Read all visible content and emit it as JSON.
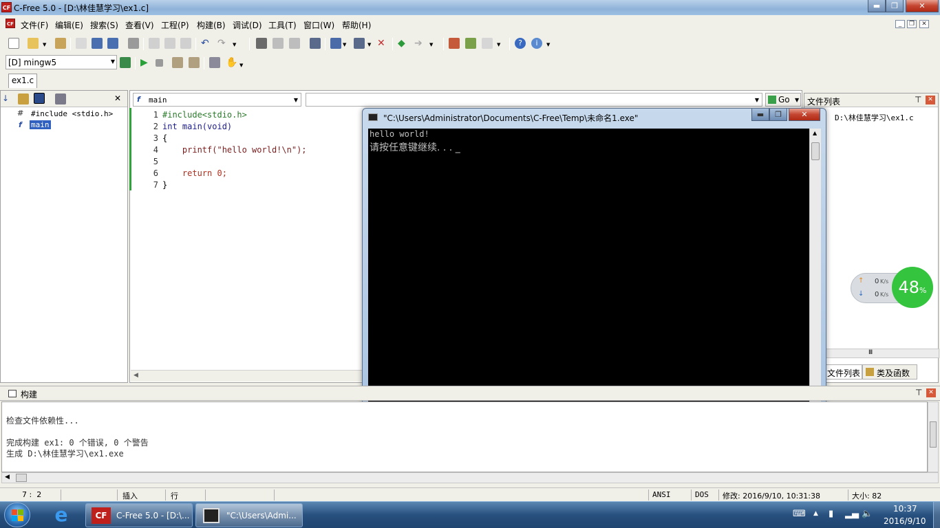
{
  "window": {
    "title": "C-Free 5.0 - [D:\\林佳慧学习\\ex1.c]",
    "logo_text": "CF",
    "minimize": "▬",
    "maximize": "❐",
    "close": "✕"
  },
  "menu": {
    "items": [
      "文件(F)",
      "编辑(E)",
      "搜索(S)",
      "查看(V)",
      "工程(P)",
      "构建(B)",
      "调试(D)",
      "工具(T)",
      "窗口(W)",
      "帮助(H)"
    ]
  },
  "toolbar": {
    "compiler": "[D] mingw5"
  },
  "tabs": {
    "document": "ex1.c"
  },
  "left_panel": {
    "items": [
      {
        "icon": "#",
        "label": "#include <stdio.h>"
      },
      {
        "icon": "f",
        "label": "main"
      }
    ]
  },
  "editor": {
    "function_combo": "main",
    "go_label": "Go",
    "lines": [
      {
        "n": "1",
        "text": "#include<stdio.h>",
        "color": "#2a7a2a"
      },
      {
        "n": "2",
        "text": "int main(void)",
        "color": "#1c1c8c"
      },
      {
        "n": "3",
        "text": "{",
        "color": "#000000"
      },
      {
        "n": "4",
        "text": "    printf(\"hello world!\\n\");",
        "color": "#7a1c1c"
      },
      {
        "n": "5",
        "text": "",
        "color": "#000000"
      },
      {
        "n": "6",
        "text": "    return 0;",
        "color": "#b03020"
      },
      {
        "n": "7",
        "text": "}",
        "color": "#000000"
      }
    ]
  },
  "right_panel": {
    "title": "文件列表",
    "file": "D:\\林佳慧学习\\ex1.c",
    "tab_files": "文件列表",
    "tab_classes": "类及函数",
    "scroll_label": "Ⅲ"
  },
  "console": {
    "title": "\"C:\\Users\\Administrator\\Documents\\C-Free\\Temp\\未命名1.exe\"",
    "lines": [
      "hello world!",
      "请按任意键继续. . . _"
    ]
  },
  "build": {
    "title": "构建",
    "lines": [
      "检查文件依赖性...",
      "",
      "完成构建 ex1: 0 个错误, 0 个警告",
      "生成 D:\\林佳慧学习\\ex1.exe"
    ]
  },
  "status": {
    "position": "7 :  2",
    "mode": "插入",
    "line_mode": "行",
    "encoding": "ANSI",
    "eol": "DOS",
    "modified": "修改: 2016/9/10, 10:31:38",
    "size": "大小: 82"
  },
  "net_meter": {
    "up": "0",
    "down": "0",
    "unit": "K/s",
    "percent": "48",
    "percent_sign": "%"
  },
  "taskbar": {
    "tasks": [
      "C-Free 5.0 - [D:\\...",
      "\"C:\\Users\\Admi..."
    ],
    "time": "10:37",
    "date": "2016/9/10"
  }
}
